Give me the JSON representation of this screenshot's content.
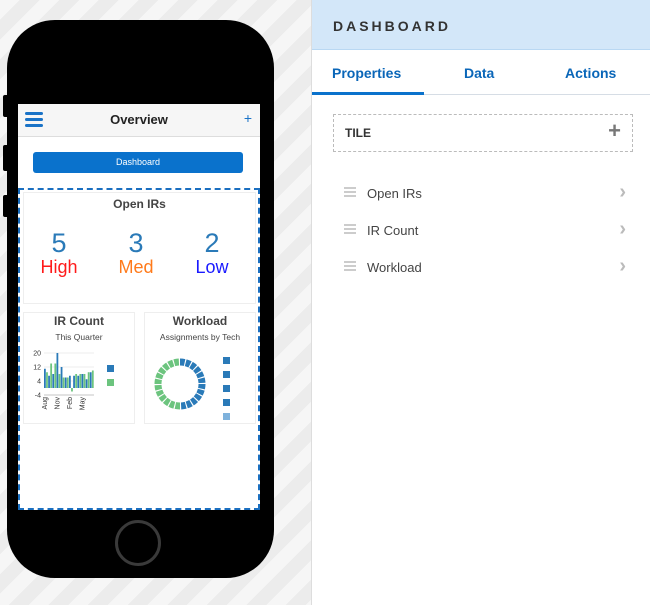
{
  "phone": {
    "title": "Overview",
    "add_icon": "plus-icon",
    "menu_icon": "hamburger-icon",
    "dashboard_button": "Dashboard",
    "open_irs": {
      "title": "Open IRs",
      "stats": [
        {
          "value": "5",
          "label": "High",
          "color": "#ff1a1a"
        },
        {
          "value": "3",
          "label": "Med",
          "color": "#ff7a1a"
        },
        {
          "value": "2",
          "label": "Low",
          "color": "#1a1aff"
        }
      ]
    },
    "ir_count": {
      "title": "IR Count",
      "subtitle": "This Quarter"
    },
    "workload": {
      "title": "Workload",
      "subtitle": "Assignments by Tech"
    }
  },
  "chart_data": [
    {
      "type": "bar",
      "yticks": [
        "20",
        "12",
        "4",
        "-4"
      ],
      "ylim": [
        -4,
        20
      ],
      "xticks": [
        "Aug",
        "Nov",
        "Feb",
        "May"
      ],
      "series": [
        {
          "color": "#2a7ab8",
          "values": [
            11,
            7,
            8,
            20,
            12,
            6,
            7,
            7,
            7,
            8,
            5,
            9
          ]
        },
        {
          "color": "#6cc47e",
          "values": [
            9,
            14,
            14,
            8,
            6,
            6,
            -2,
            8,
            8,
            8,
            9,
            10
          ]
        }
      ]
    },
    {
      "type": "pie",
      "donut": true,
      "colors": {
        "blue": "#2a7ab8",
        "green": "#6cc47e"
      },
      "values": [
        1,
        1,
        1,
        1,
        1,
        1,
        1,
        1,
        1,
        1,
        1,
        1,
        1,
        1,
        1,
        1,
        1,
        1,
        1,
        1,
        1,
        1,
        1,
        1
      ]
    }
  ],
  "panel": {
    "header": "DASHBOARD",
    "tabs": [
      {
        "label": "Properties",
        "active": true
      },
      {
        "label": "Data"
      },
      {
        "label": "Actions"
      }
    ],
    "tile_label": "TILE",
    "items": [
      {
        "label": "Open IRs"
      },
      {
        "label": "IR Count"
      },
      {
        "label": "Workload"
      }
    ]
  }
}
